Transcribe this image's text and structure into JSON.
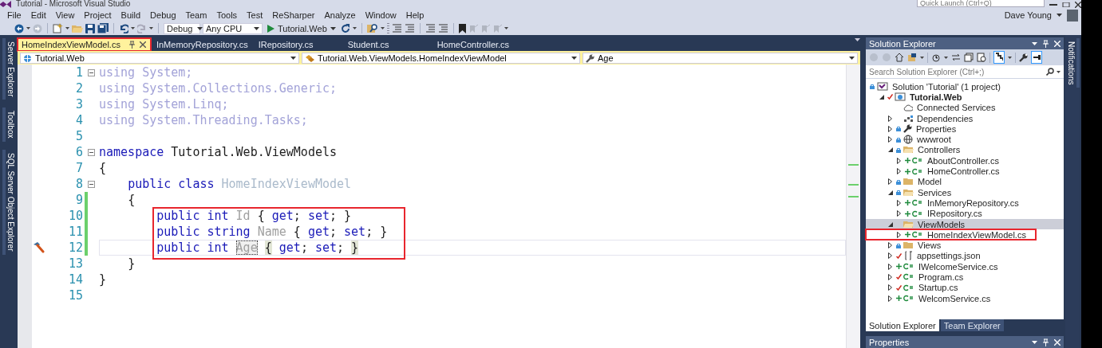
{
  "window": {
    "title": "Tutorial - Microsoft Visual Studio",
    "quick_launch": {
      "placeholder": "Quick Launch (Ctrl+Q)"
    },
    "user": "Dave Young"
  },
  "menu": [
    "File",
    "Edit",
    "View",
    "Project",
    "Build",
    "Debug",
    "Team",
    "Tools",
    "Test",
    "ReSharper",
    "Analyze",
    "Window",
    "Help"
  ],
  "toolbar": {
    "configuration": "Debug",
    "platform": "Any CPU",
    "start": "Tutorial.Web"
  },
  "left_tool_tabs": [
    "Server Explorer",
    "Toolbox",
    "SQL Server Object Explorer"
  ],
  "right_tool_tabs": [
    "Notifications"
  ],
  "editor": {
    "tabs": [
      {
        "label": "HomeIndexViewModel.cs",
        "selected": true,
        "highlighted": true
      },
      {
        "label": "InMemoryRepository.cs",
        "selected": false,
        "highlighted": false
      },
      {
        "label": "IRepository.cs",
        "selected": false,
        "highlighted": false
      },
      {
        "label": "Student.cs",
        "selected": false,
        "highlighted": false
      },
      {
        "label": "HomeController.cs",
        "selected": false,
        "highlighted": false
      }
    ],
    "navigation": {
      "project": "Tutorial.Web",
      "type": "Tutorial.Web.ViewModels.HomeIndexViewModel",
      "member": "Age"
    },
    "lines": [
      {
        "number": "1",
        "fold": true,
        "changed": false,
        "current": false,
        "boxed": false,
        "quick_action": false,
        "tokens": [
          {
            "text": "using System;",
            "kind": "unused"
          }
        ]
      },
      {
        "number": "2",
        "fold": false,
        "changed": false,
        "current": false,
        "boxed": false,
        "quick_action": false,
        "tokens": [
          {
            "text": "using System.Collections.Generic;",
            "kind": "unused"
          }
        ]
      },
      {
        "number": "3",
        "fold": false,
        "changed": false,
        "current": false,
        "boxed": false,
        "quick_action": false,
        "tokens": [
          {
            "text": "using System.Linq;",
            "kind": "unused"
          }
        ]
      },
      {
        "number": "4",
        "fold": false,
        "changed": false,
        "current": false,
        "boxed": false,
        "quick_action": false,
        "tokens": [
          {
            "text": "using System.Threading.Tasks;",
            "kind": "unused"
          }
        ]
      },
      {
        "number": "5",
        "fold": false,
        "changed": false,
        "current": false,
        "boxed": false,
        "quick_action": false
      },
      {
        "number": "6",
        "fold": true,
        "changed": false,
        "current": false,
        "boxed": false,
        "quick_action": false,
        "tokens": [
          {
            "text": "namespace",
            "kind": "keyword"
          },
          {
            "text": " Tutorial.Web.ViewModels",
            "kind": "plain"
          }
        ]
      },
      {
        "number": "7",
        "fold": false,
        "changed": false,
        "current": false,
        "boxed": false,
        "quick_action": false,
        "tokens": [
          {
            "text": "{",
            "kind": "plain"
          }
        ]
      },
      {
        "number": "8",
        "fold": true,
        "changed": false,
        "current": false,
        "boxed": false,
        "quick_action": false,
        "tokens": [
          {
            "text": "    public class",
            "kind": "keyword"
          },
          {
            "text": " HomeIndexViewModel",
            "kind": "type"
          }
        ]
      },
      {
        "number": "9",
        "fold": false,
        "changed": true,
        "current": false,
        "boxed": false,
        "quick_action": false,
        "tokens": [
          {
            "text": "    {",
            "kind": "plain"
          }
        ]
      },
      {
        "number": "10",
        "fold": false,
        "changed": true,
        "current": false,
        "boxed": true,
        "quick_action": false,
        "tokens": [
          {
            "text": "        public int",
            "kind": "keyword"
          },
          {
            "text": " Id",
            "kind": "member"
          },
          {
            "text": " {",
            "kind": "plain"
          },
          {
            "text": " get",
            "kind": "keyword"
          },
          {
            "text": ";",
            "kind": "plain"
          },
          {
            "text": " set",
            "kind": "keyword"
          },
          {
            "text": "; }",
            "kind": "plain"
          }
        ]
      },
      {
        "number": "11",
        "fold": false,
        "changed": true,
        "current": false,
        "boxed": true,
        "quick_action": false,
        "tokens": [
          {
            "text": "        public string",
            "kind": "keyword"
          },
          {
            "text": " Name",
            "kind": "member"
          },
          {
            "text": " {",
            "kind": "plain"
          },
          {
            "text": " get",
            "kind": "keyword"
          },
          {
            "text": ";",
            "kind": "plain"
          },
          {
            "text": " set",
            "kind": "keyword"
          },
          {
            "text": "; }",
            "kind": "plain"
          }
        ]
      },
      {
        "number": "12",
        "fold": false,
        "changed": true,
        "current": true,
        "boxed": true,
        "quick_action": true,
        "tokens": [
          {
            "text": "        public int",
            "kind": "keyword"
          },
          {
            "text": " Age",
            "kind": "rename"
          },
          {
            "text": " {",
            "kind": "brace-match"
          },
          {
            "text": " get",
            "kind": "keyword"
          },
          {
            "text": ";",
            "kind": "plain"
          },
          {
            "text": " set",
            "kind": "keyword"
          },
          {
            "text": ";",
            "kind": "plain"
          },
          {
            "text": " }",
            "kind": "brace-match"
          }
        ]
      },
      {
        "number": "13",
        "fold": false,
        "changed": false,
        "current": false,
        "boxed": false,
        "quick_action": false,
        "tokens": [
          {
            "text": "    }",
            "kind": "plain"
          }
        ]
      },
      {
        "number": "14",
        "fold": false,
        "changed": false,
        "current": false,
        "boxed": false,
        "quick_action": false,
        "tokens": [
          {
            "text": "}",
            "kind": "plain"
          }
        ]
      },
      {
        "number": "15",
        "fold": false,
        "changed": false,
        "current": false,
        "boxed": false,
        "quick_action": false
      }
    ]
  },
  "solution_explorer": {
    "title": "Solution Explorer",
    "search": {
      "placeholder": "Search Solution Explorer (Ctrl+;)"
    },
    "tree": [
      {
        "label": "Solution 'Tutorial' (1 project)",
        "kind": "solution",
        "locked": true,
        "added": false,
        "checked_out": false,
        "selected": false,
        "highlighted": false,
        "children": [
          {
            "label": "Tutorial.Web",
            "kind": "project",
            "locked": false,
            "added": false,
            "checked_out": true,
            "expanded": true,
            "selected": false,
            "highlighted": false,
            "children": [
              {
                "label": "Connected Services",
                "kind": "cloud",
                "locked": false,
                "added": false,
                "checked_out": false,
                "selected": false,
                "highlighted": false
              },
              {
                "label": "Dependencies",
                "kind": "dependencies",
                "locked": false,
                "added": false,
                "checked_out": false,
                "expanded": false,
                "selected": false,
                "highlighted": false
              },
              {
                "label": "Properties",
                "kind": "wrench",
                "locked": true,
                "added": false,
                "checked_out": false,
                "expanded": false,
                "selected": false,
                "highlighted": false
              },
              {
                "label": "wwwroot",
                "kind": "globe",
                "locked": true,
                "added": false,
                "checked_out": false,
                "expanded": false,
                "selected": false,
                "highlighted": false
              },
              {
                "label": "Controllers",
                "kind": "folder",
                "locked": true,
                "added": false,
                "checked_out": false,
                "expanded": true,
                "selected": false,
                "highlighted": false,
                "children": [
                  {
                    "label": "AboutController.cs",
                    "kind": "csharp",
                    "locked": false,
                    "added": true,
                    "checked_out": false,
                    "expanded": false,
                    "selected": false,
                    "highlighted": false
                  },
                  {
                    "label": "HomeController.cs",
                    "kind": "csharp",
                    "locked": false,
                    "added": true,
                    "checked_out": false,
                    "expanded": false,
                    "selected": false,
                    "highlighted": false
                  }
                ]
              },
              {
                "label": "Model",
                "kind": "folder",
                "locked": true,
                "added": false,
                "checked_out": false,
                "expanded": false,
                "selected": false,
                "highlighted": false
              },
              {
                "label": "Services",
                "kind": "folder",
                "locked": true,
                "added": false,
                "checked_out": false,
                "expanded": true,
                "selected": false,
                "highlighted": false,
                "children": [
                  {
                    "label": "InMemoryRepository.cs",
                    "kind": "csharp",
                    "locked": false,
                    "added": true,
                    "checked_out": false,
                    "expanded": false,
                    "selected": false,
                    "highlighted": false
                  },
                  {
                    "label": "IRepository.cs",
                    "kind": "csharp",
                    "locked": false,
                    "added": true,
                    "checked_out": false,
                    "expanded": false,
                    "selected": false,
                    "highlighted": false
                  }
                ]
              },
              {
                "label": "ViewModels",
                "kind": "folder",
                "locked": false,
                "added": false,
                "checked_out": false,
                "expanded": true,
                "selected": true,
                "highlighted": false,
                "children": [
                  {
                    "label": "HomeIndexViewModel.cs",
                    "kind": "csharp",
                    "locked": false,
                    "added": true,
                    "checked_out": false,
                    "expanded": false,
                    "selected": false,
                    "highlighted": true
                  }
                ]
              },
              {
                "label": "Views",
                "kind": "folder",
                "locked": true,
                "added": false,
                "checked_out": false,
                "expanded": false,
                "selected": false,
                "highlighted": false
              },
              {
                "label": "appsettings.json",
                "kind": "json",
                "locked": false,
                "added": false,
                "checked_out": true,
                "expanded": false,
                "selected": false,
                "highlighted": false
              },
              {
                "label": "IWelcomeService.cs",
                "kind": "csharp",
                "locked": false,
                "added": true,
                "checked_out": false,
                "expanded": false,
                "selected": false,
                "highlighted": false
              },
              {
                "label": "Program.cs",
                "kind": "csharp",
                "locked": false,
                "added": false,
                "checked_out": true,
                "expanded": false,
                "selected": false,
                "highlighted": false
              },
              {
                "label": "Startup.cs",
                "kind": "csharp",
                "locked": false,
                "added": false,
                "checked_out": true,
                "expanded": false,
                "selected": false,
                "highlighted": false
              },
              {
                "label": "WelcomService.cs",
                "kind": "csharp",
                "locked": false,
                "added": true,
                "checked_out": false,
                "expanded": false,
                "selected": false,
                "highlighted": false
              }
            ]
          }
        ]
      }
    ],
    "tabs": [
      {
        "label": "Solution Explorer",
        "selected": true
      },
      {
        "label": "Team Explorer",
        "selected": false
      }
    ]
  },
  "properties": {
    "title": "Properties"
  }
}
